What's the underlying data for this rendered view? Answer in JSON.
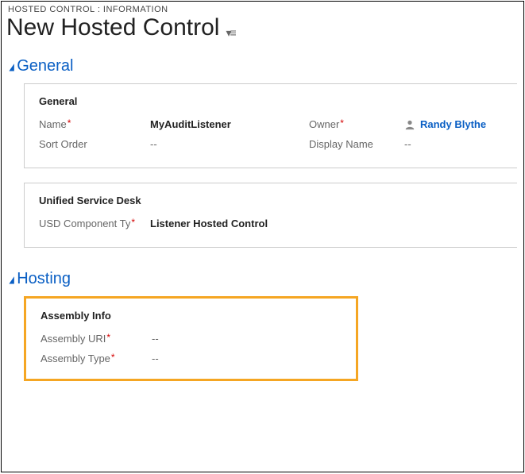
{
  "breadcrumb": "HOSTED CONTROL : INFORMATION",
  "page_title": "New Hosted Control",
  "sections": {
    "general": {
      "title": "General",
      "panel1": {
        "title": "General",
        "name_label": "Name",
        "name_value": "MyAuditListener",
        "owner_label": "Owner",
        "owner_value": "Randy Blythe",
        "sort_order_label": "Sort Order",
        "sort_order_value": "--",
        "display_name_label": "Display Name",
        "display_name_value": "--"
      },
      "panel2": {
        "title": "Unified Service Desk",
        "usd_comp_label": "USD Component Ty",
        "usd_comp_value": "Listener Hosted Control"
      }
    },
    "hosting": {
      "title": "Hosting",
      "panel1": {
        "title": "Assembly Info",
        "assembly_uri_label": "Assembly URI",
        "assembly_uri_value": "--",
        "assembly_type_label": "Assembly Type",
        "assembly_type_value": "--"
      }
    }
  }
}
